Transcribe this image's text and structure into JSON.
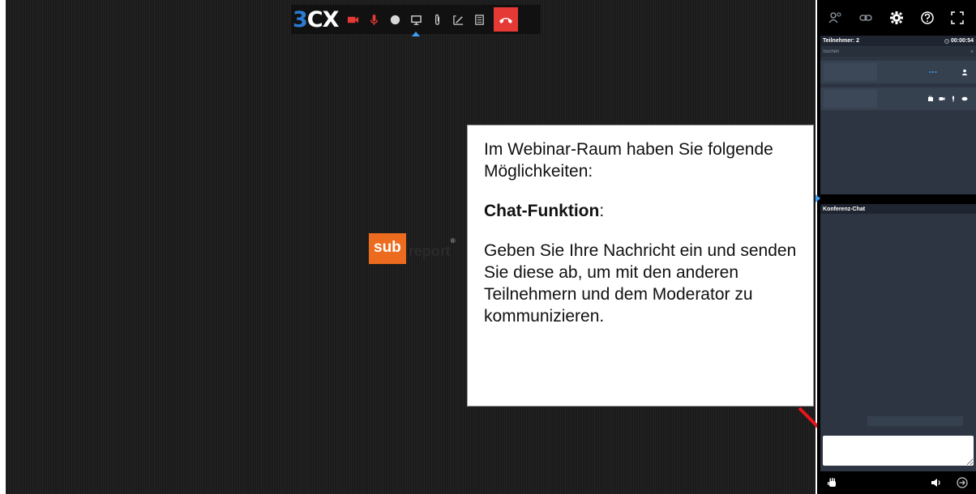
{
  "toolbar": {
    "brand_num": "3",
    "brand_text": "CX",
    "buttons": [
      "video-icon",
      "microphone-icon",
      "record-icon",
      "screen-share-icon",
      "attachment-icon",
      "whiteboard-icon",
      "document-icon",
      "hangup-icon"
    ],
    "colors": {
      "muted": "#e53935",
      "hangup_bg": "#e53935",
      "brand_accent": "#2b7bd3"
    }
  },
  "logo": {
    "sub": "sub",
    "report": "report",
    "reg": "®"
  },
  "callout": {
    "line1": "Im Webinar-Raum haben Sie folgende Möglichkeiten:",
    "heading": "Chat-Funktion",
    "heading_suffix": ":",
    "body": "Geben Sie Ihre Nachricht ein und senden Sie diese ab, um mit den anderen Teilnehmern und dem Moderator zu kommunizieren."
  },
  "panel": {
    "top_icons": [
      "participants-icon",
      "link-icon",
      "settings-gear-icon",
      "help-icon",
      "fullscreen-icon"
    ],
    "participants_title": "Teilnehmer: 2",
    "timer": "00:00:54",
    "search_placeholder": "Suchen",
    "search_clear": "×",
    "chat_title": "Konferenz-Chat",
    "bottom_icons": [
      "raise-hand-icon",
      "speaker-icon",
      "leave-icon"
    ]
  }
}
